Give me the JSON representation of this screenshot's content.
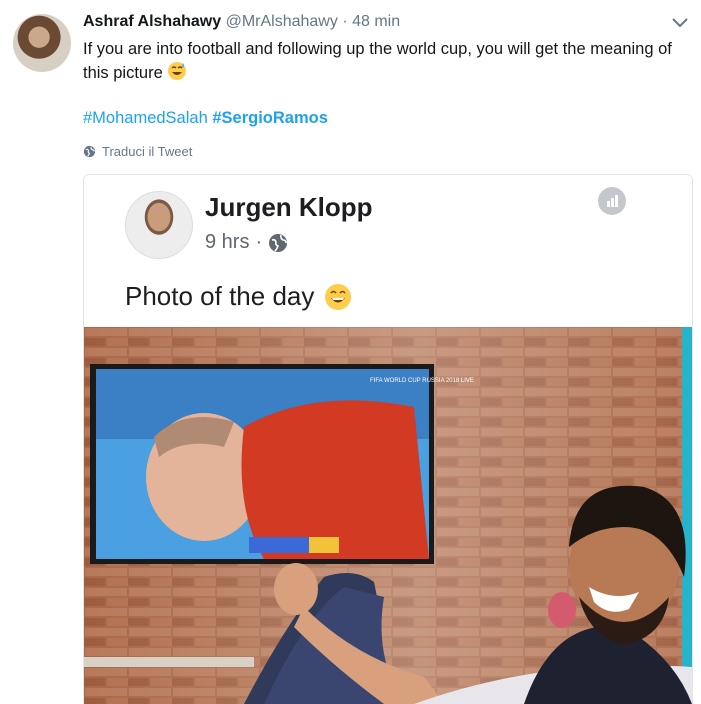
{
  "tweet": {
    "display_name": "Ashraf Alshahawy",
    "handle": "@MrAlshahawy",
    "time": "· 48 min",
    "text": "If you are into football and following up the world cup, you will get the meaning of this picture",
    "hashtags": [
      "#MohamedSalah",
      "#SergioRamos"
    ],
    "translate_label": "Traduci il Tweet"
  },
  "embedded_post": {
    "author": "Jurgen Klopp",
    "time": "9 hrs",
    "separator": "·",
    "text": "Photo of the day",
    "tv_overlay": "FIFA WORLD CUP RUSSIA 2018 LIVE"
  },
  "colors": {
    "link": "#1da1f2",
    "secondary_text": "#657786",
    "brick": "#9c5a3c",
    "jersey_red": "#d23a24"
  },
  "icons": [
    "chevron-down-icon",
    "globe-icon",
    "stats-icon",
    "grinning-sweat-emoji",
    "smiling-emoji"
  ]
}
